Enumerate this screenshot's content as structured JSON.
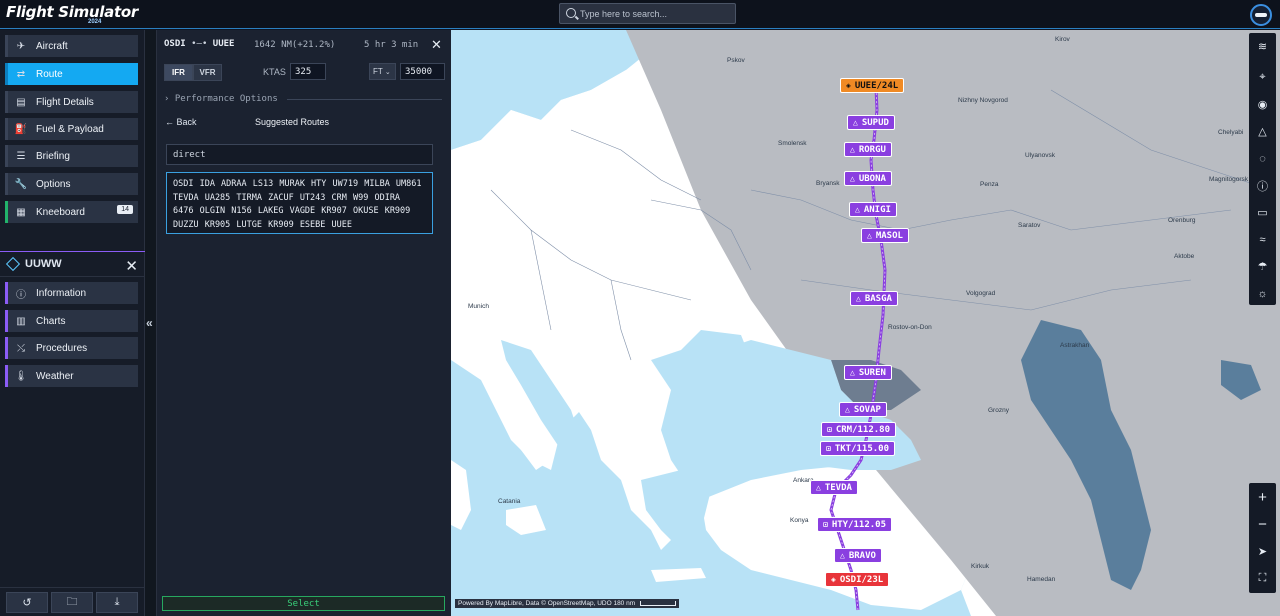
{
  "app": {
    "logo_text": "Flight Simulator",
    "logo_year": "2024",
    "search_placeholder": "Type here to search..."
  },
  "sidebar": {
    "items": [
      {
        "label": "Aircraft",
        "icon": "airplane-icon"
      },
      {
        "label": "Route",
        "icon": "route-icon",
        "active": true
      },
      {
        "label": "Flight Details",
        "icon": "document-icon"
      },
      {
        "label": "Fuel & Payload",
        "icon": "fuel-icon"
      },
      {
        "label": "Briefing",
        "icon": "list-icon"
      },
      {
        "label": "Options",
        "icon": "wrench-icon"
      },
      {
        "label": "Kneeboard",
        "icon": "clipboard-icon",
        "badge": "14"
      }
    ],
    "airport": {
      "code": "UUWW",
      "items": [
        {
          "label": "Information",
          "icon": "info-icon"
        },
        {
          "label": "Charts",
          "icon": "map-icon"
        },
        {
          "label": "Procedures",
          "icon": "procedure-icon"
        },
        {
          "label": "Weather",
          "icon": "thermometer-icon"
        }
      ]
    }
  },
  "panel": {
    "origin": "OSDI",
    "destination": "UUEE",
    "distance": "1642 NM(+21.2%)",
    "duration": "5 hr 3 min",
    "ifr_label": "IFR",
    "vfr_label": "VFR",
    "ktas_label": "KTAS",
    "ktas_value": "325",
    "alt_unit": "FT",
    "altitude": "35000",
    "performance_label": "Performance Options",
    "back_label": "Back",
    "suggested_title": "Suggested Routes",
    "direct_label": "direct",
    "route_string": "OSDI IDA ADRAA LS13 MURAK HTY UW719 MILBA UM861 TEVDA UA285 TIRMA ZACUF UT243 CRM W99 ODIRA 6476 OLGIN N156 LAKEG VAGDE KR907 OKUSE KR909 DUZZU KR905 LUTGE KR909 ESEBE UUEE",
    "select_label": "Select"
  },
  "map": {
    "waypoints": [
      {
        "label": "UUEE/24L",
        "type": "airport-dest"
      },
      {
        "label": "SUPUD",
        "type": "fix"
      },
      {
        "label": "RORGU",
        "type": "fix"
      },
      {
        "label": "UBONA",
        "type": "fix"
      },
      {
        "label": "ANIGI",
        "type": "fix"
      },
      {
        "label": "MASOL",
        "type": "fix"
      },
      {
        "label": "BASGA",
        "type": "fix"
      },
      {
        "label": "SUREN",
        "type": "fix"
      },
      {
        "label": "SOVAP",
        "type": "fix"
      },
      {
        "label": "CRM/112.80",
        "type": "vor"
      },
      {
        "label": "TKT/115.00",
        "type": "vor"
      },
      {
        "label": "TEVDA",
        "type": "fix"
      },
      {
        "label": "HTY/112.05",
        "type": "vor"
      },
      {
        "label": "BRAVO",
        "type": "fix"
      },
      {
        "label": "OSDI/23L",
        "type": "airport-origin"
      }
    ],
    "cities": [
      "Pskov",
      "Kirov",
      "Smolensk",
      "Nizhny Novgorod",
      "Bryansk",
      "Penza",
      "Ulyanovsk",
      "Saratov",
      "Volgograd",
      "Rostov-on-Don",
      "Astrakhan",
      "Orenburg",
      "Aktobe",
      "Magnitogorsk",
      "Chelyabi",
      "Grozny",
      "Munich",
      "Catania",
      "Konya",
      "Ankara",
      "Hamedan",
      "Kirkuk"
    ],
    "attribution": "Powered By MapLibre, Data © OpenStreetMap, UDO",
    "scale_label": "180 nm",
    "colors": {
      "sea": "#b8e2f6",
      "land": "#ffffff",
      "night": "#b9bcc2",
      "route": "#8a3fe0",
      "origin": "#e8343a",
      "destination": "#f08a24"
    }
  }
}
